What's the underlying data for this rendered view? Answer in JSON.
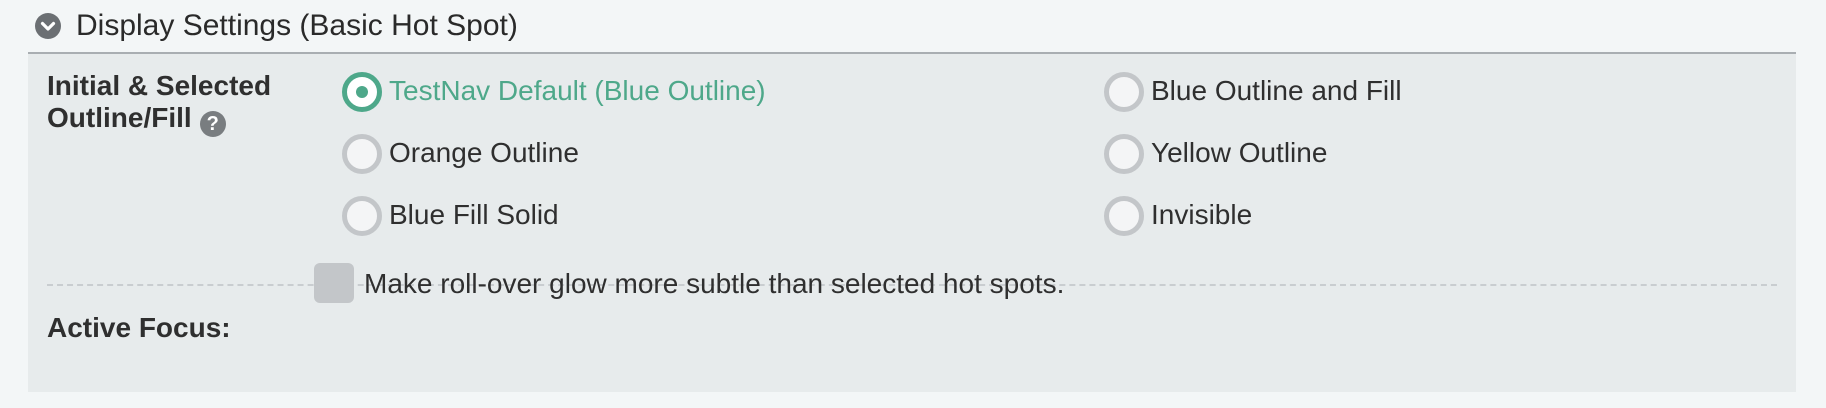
{
  "section": {
    "title": "Display Settings (Basic Hot Spot)",
    "toggle_icon": "chevron-down-circle-icon"
  },
  "outline_fill": {
    "label_line1": "Initial & Selected",
    "label_line2": "Outline/Fill",
    "help_icon": "question-circle-icon",
    "help_glyph": "?",
    "selected": "TestNav Default (Blue Outline)",
    "options": [
      {
        "label": "TestNav Default (Blue Outline)",
        "checked": true
      },
      {
        "label": "Blue Outline and Fill",
        "checked": false
      },
      {
        "label": "Orange Outline",
        "checked": false
      },
      {
        "label": "Yellow Outline",
        "checked": false
      },
      {
        "label": "Blue Fill Solid",
        "checked": false
      },
      {
        "label": "Invisible",
        "checked": false
      }
    ]
  },
  "active_focus": {
    "label": "Active Focus:",
    "checkbox_label": "Make roll-over glow more subtle than selected hot spots.",
    "checked": false
  },
  "colors": {
    "accent": "#4ea88a",
    "panel_bg": "#e7ebec",
    "page_bg": "#f3f6f7",
    "radio_border": "#c3c6c9"
  }
}
